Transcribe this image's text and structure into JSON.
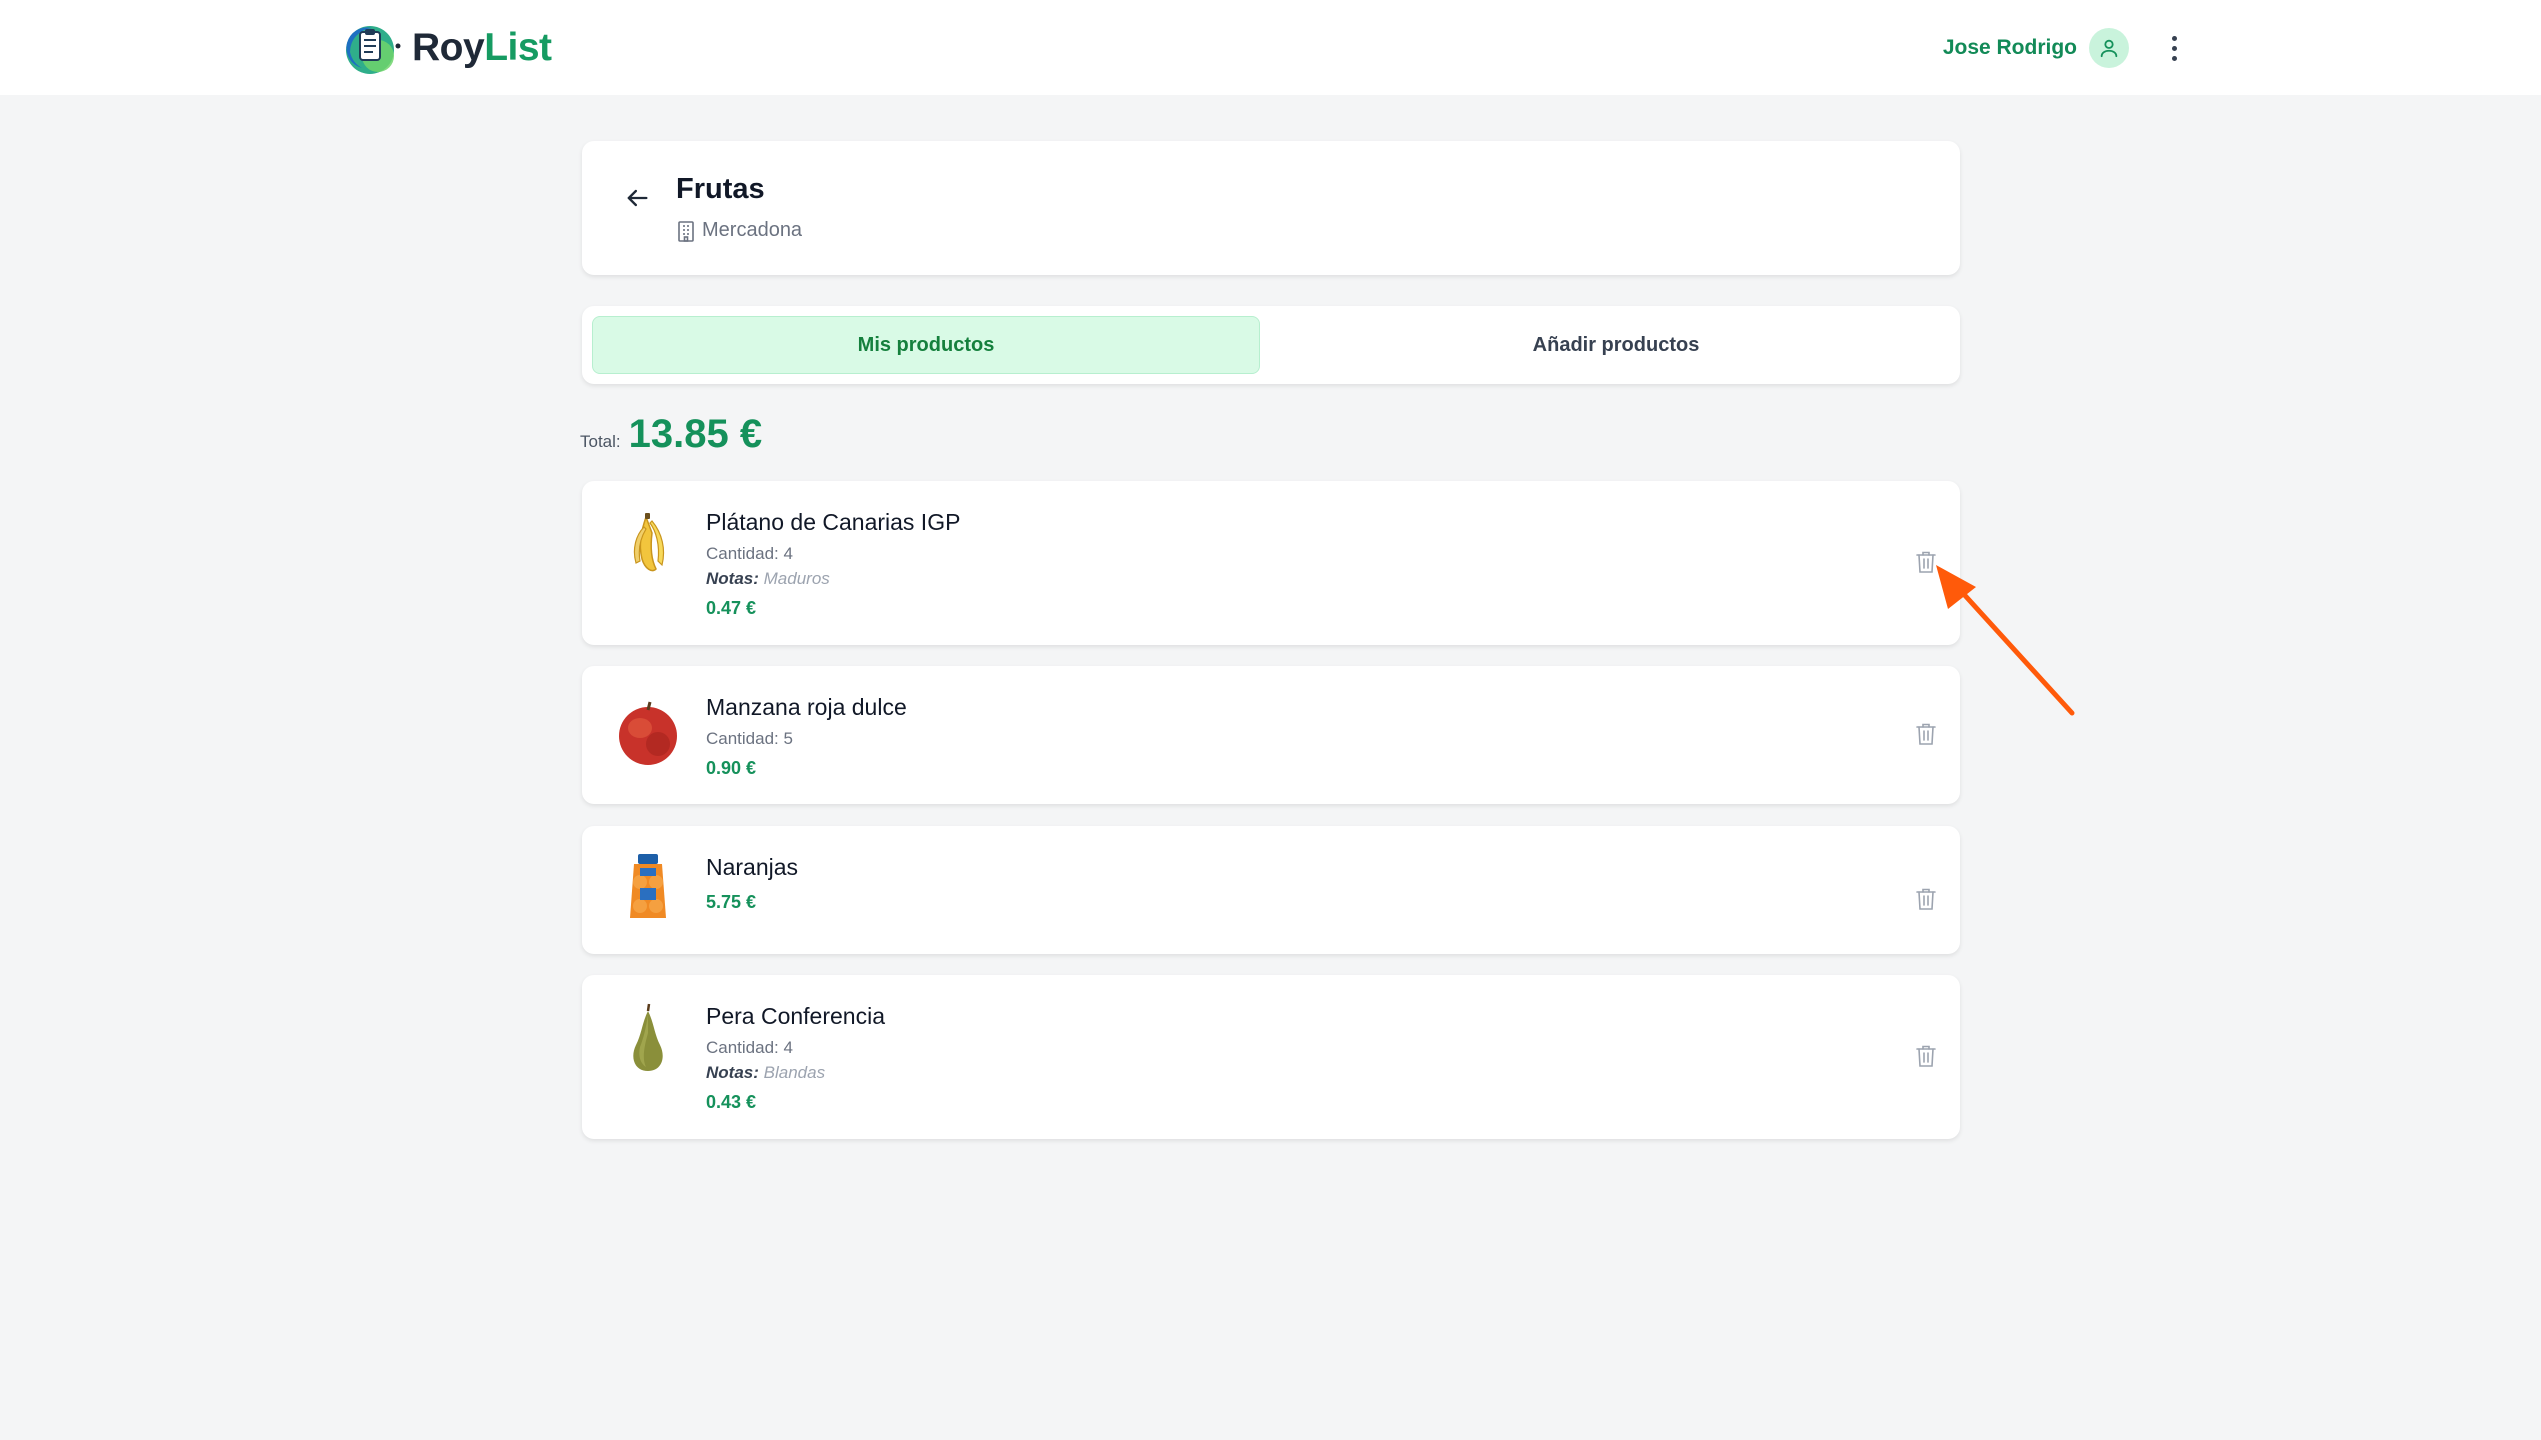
{
  "app": {
    "brand_part1": "Roy",
    "brand_part2": "List",
    "user_name": "Jose Rodrigo"
  },
  "list": {
    "title": "Frutas",
    "store": "Mercadona"
  },
  "tabs": [
    {
      "label": "Mis productos",
      "active": true
    },
    {
      "label": "Añadir productos",
      "active": false
    }
  ],
  "total": {
    "label": "Total:",
    "value": "13.85 €"
  },
  "products": [
    {
      "name": "Plátano de Canarias IGP",
      "quantity": "Cantidad: 4",
      "notes_label": "Notas:",
      "notes": "Maduros",
      "price": "0.47 €",
      "icon": "banana-image"
    },
    {
      "name": "Manzana roja dulce",
      "quantity": "Cantidad: 5",
      "price": "0.90 €",
      "icon": "apple-image"
    },
    {
      "name": "Naranjas",
      "price": "5.75 €",
      "icon": "orange-bag-image"
    },
    {
      "name": "Pera Conferencia",
      "quantity": "Cantidad: 4",
      "notes_label": "Notas:",
      "notes": "Blandas",
      "price": "0.43 €",
      "icon": "pear-image"
    }
  ],
  "colors": {
    "accent": "#15915b",
    "tab_active_bg": "#d9fae6",
    "annotation_arrow": "#ff5a0a"
  }
}
